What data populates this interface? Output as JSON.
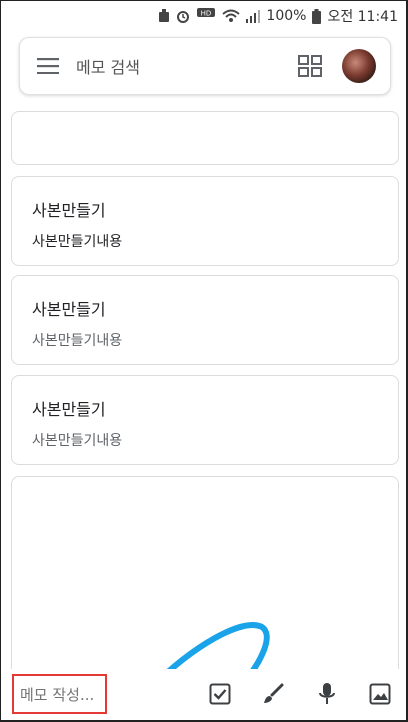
{
  "status": {
    "battery": "100%",
    "time": "오전 11:41",
    "voice_label": "Voice"
  },
  "search": {
    "placeholder": "메모 검색"
  },
  "notes": [
    {
      "title": "사본만들기",
      "body": "사본만들기내용"
    },
    {
      "title": "사본만들기",
      "body": "사본만들기내용"
    },
    {
      "title": "사본만들기",
      "body": "사본만들기내용"
    }
  ],
  "compose": {
    "placeholder": "메모 작성..."
  },
  "colors": {
    "accent": "#e53935",
    "stroke": "#1aa3e8",
    "note_border": "#dadce0"
  },
  "icons": [
    "menu-icon",
    "grid-view-icon",
    "checkbox-icon",
    "brush-icon",
    "mic-icon",
    "image-icon"
  ]
}
